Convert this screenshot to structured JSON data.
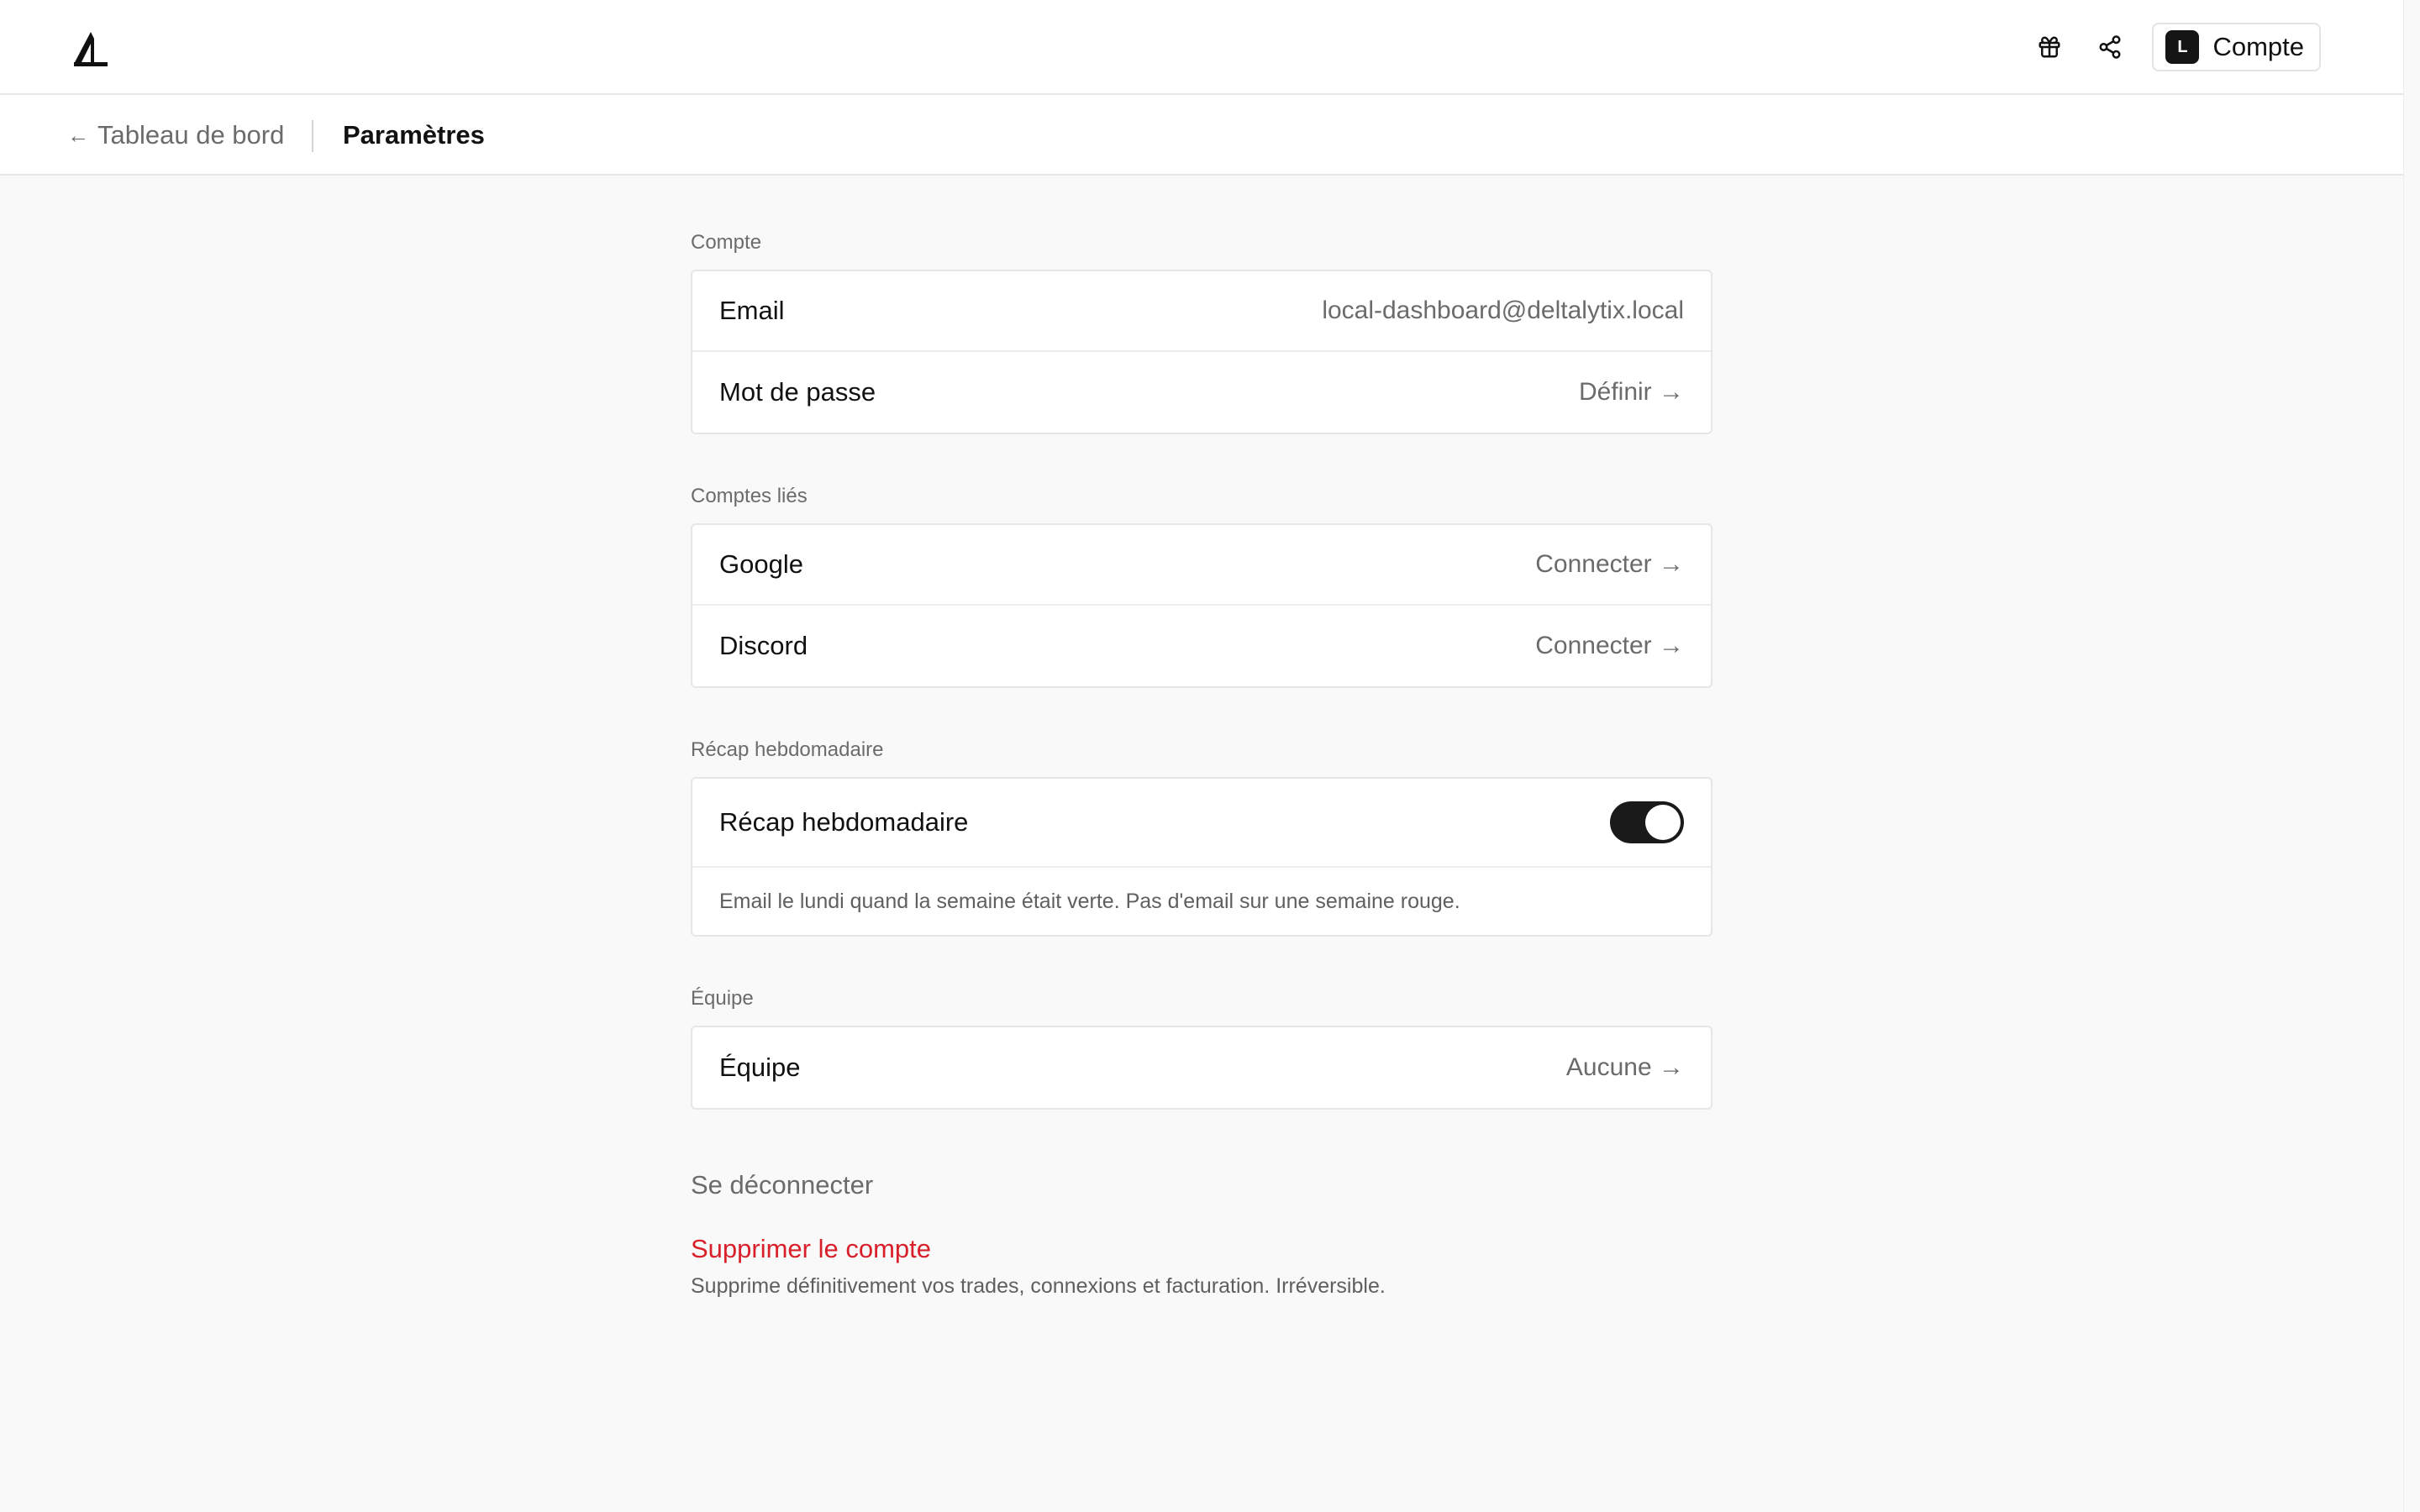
{
  "header": {
    "logo_icon": "delta-logo-icon",
    "gift_icon": "gift-icon",
    "share_icon": "share-icon",
    "account": {
      "avatar_letter": "L",
      "label": "Compte"
    }
  },
  "subnav": {
    "back_arrow": "←",
    "back_label": "Tableau de bord",
    "title": "Paramètres"
  },
  "sections": {
    "compte": {
      "title": "Compte",
      "email_label": "Email",
      "email_value": "local-dashboard@deltalytix.local",
      "password_label": "Mot de passe",
      "password_action": "Définir →"
    },
    "linked": {
      "title": "Comptes liés",
      "google_label": "Google",
      "google_action": "Connecter →",
      "discord_label": "Discord",
      "discord_action": "Connecter →"
    },
    "recap": {
      "title": "Récap hebdomadaire",
      "toggle_label": "Récap hebdomadaire",
      "toggle_on": true,
      "description": "Email le lundi quand la semaine était verte. Pas d'email sur une semaine rouge."
    },
    "team": {
      "title": "Équipe",
      "team_label": "Équipe",
      "team_value": "Aucune →"
    }
  },
  "actions": {
    "logout": "Se déconnecter",
    "delete": "Supprimer le compte",
    "delete_description": "Supprime définitivement vos trades, connexions et facturation. Irréversible."
  },
  "colors": {
    "background": "#f9f9f9",
    "surface": "#ffffff",
    "danger": "#d9202a",
    "toggle_on": "#1a1a1a"
  }
}
